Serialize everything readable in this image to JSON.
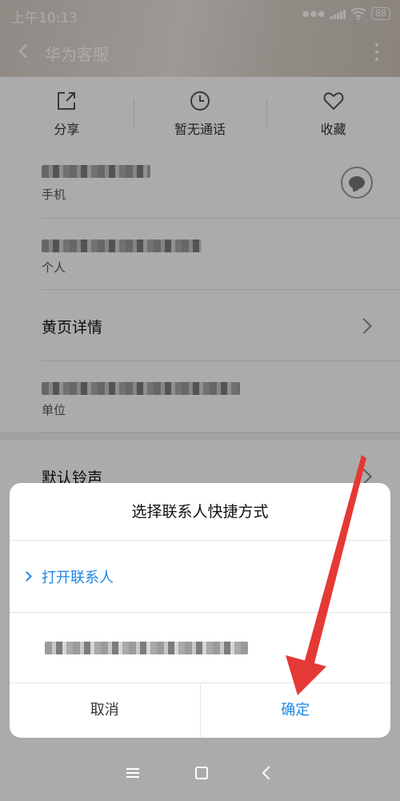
{
  "status_bar": {
    "time": "上午10:13",
    "battery": "88"
  },
  "header": {
    "title": "华为客服"
  },
  "actions": [
    {
      "label": "分享",
      "icon": "share-icon"
    },
    {
      "label": "暂无通话",
      "icon": "clock-icon"
    },
    {
      "label": "收藏",
      "icon": "heart-icon"
    }
  ],
  "rows": {
    "phone_label": "手机",
    "personal_label": "个人",
    "yellow_pages": "黄页详情",
    "work_label": "单位",
    "ringtone": "默认铃声"
  },
  "dialog": {
    "title": "选择联系人快捷方式",
    "option_open": "打开联系人",
    "cancel": "取消",
    "confirm": "确定"
  },
  "colors": {
    "accent": "#1e88e5",
    "annotation_arrow": "#e53935"
  }
}
